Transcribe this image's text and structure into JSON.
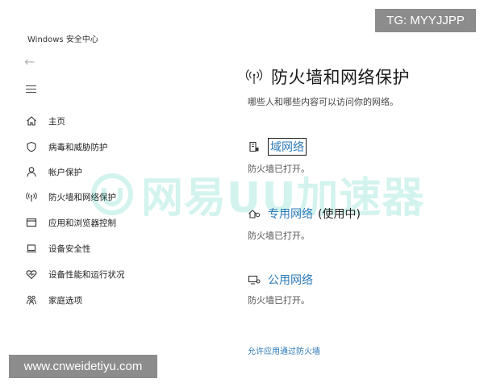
{
  "window": {
    "title": "Windows 安全中心"
  },
  "nav": {
    "items": [
      {
        "label": "主页",
        "icon": "home-icon"
      },
      {
        "label": "病毒和威胁防护",
        "icon": "shield-icon"
      },
      {
        "label": "帐户保护",
        "icon": "person-icon"
      },
      {
        "label": "防火墙和网络保护",
        "icon": "wireless-icon"
      },
      {
        "label": "应用和浏览器控制",
        "icon": "browser-window-icon"
      },
      {
        "label": "设备安全性",
        "icon": "laptop-icon"
      },
      {
        "label": "设备性能和运行状况",
        "icon": "heart-icon"
      },
      {
        "label": "家庭选项",
        "icon": "family-icon"
      }
    ]
  },
  "main": {
    "title": "防火墙和网络保护",
    "description": "哪些人和哪些内容可以访问你的网络。",
    "networks": [
      {
        "name": "域网络",
        "suffix": "",
        "status": "防火墙已打开。",
        "icon": "building-icon"
      },
      {
        "name": "专用网络",
        "suffix": "(使用中)",
        "status": "防火墙已打开。",
        "icon": "home-network-icon"
      },
      {
        "name": "公用网络",
        "suffix": "",
        "status": "防火墙已打开。",
        "icon": "public-network-icon"
      }
    ],
    "allow_link": "允许应用通过防火墙"
  },
  "overlays": {
    "tg_badge": "TG: MYYJJPP",
    "site_badge": "www.cnweidetiyu.com",
    "watermark_text": "网易UU加速器"
  },
  "colors": {
    "link": "#2c7ab8",
    "watermark": "#14c2a7",
    "badge_bg": "#8c8c8c"
  }
}
